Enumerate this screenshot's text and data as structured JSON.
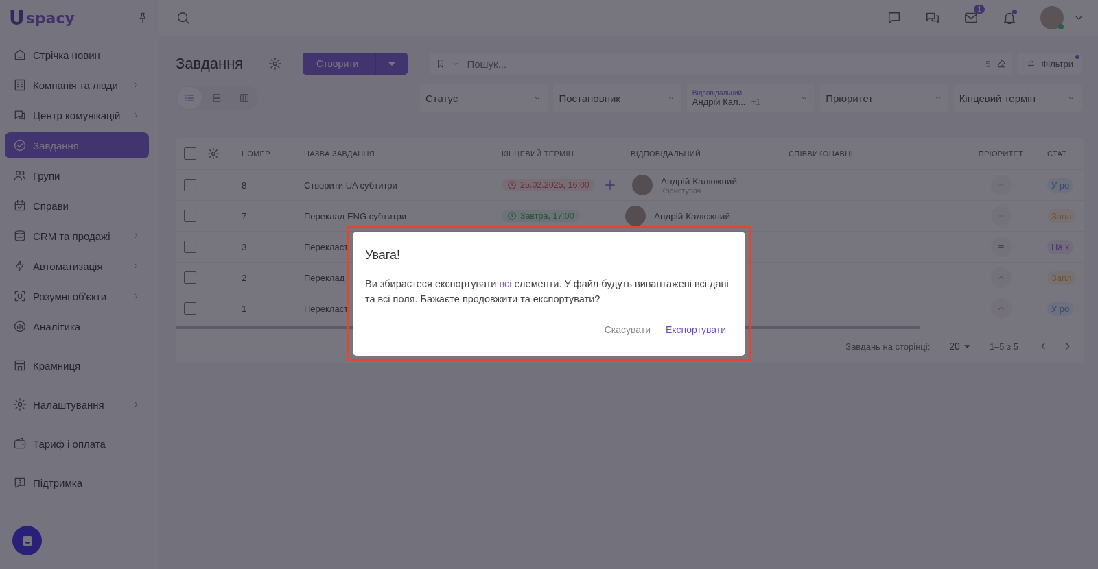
{
  "sidebar": {
    "logo": {
      "letter": "U",
      "text": "spacy"
    },
    "sections": [
      {
        "items": [
          {
            "label": "Стрічка новин",
            "kind": "home",
            "submenu": false,
            "selected": false
          },
          {
            "label": "Компанія та люди",
            "kind": "building",
            "submenu": true,
            "selected": false
          },
          {
            "label": "Центр комунікацій",
            "kind": "chat",
            "submenu": true,
            "selected": false
          },
          {
            "label": "Завдання",
            "kind": "check",
            "submenu": false,
            "selected": true
          },
          {
            "label": "Групи",
            "kind": "people",
            "submenu": false,
            "selected": false
          },
          {
            "label": "Справи",
            "kind": "calendar",
            "submenu": false,
            "selected": false
          },
          {
            "label": "CRM та продажі",
            "kind": "stack",
            "submenu": true,
            "selected": false
          },
          {
            "label": "Автоматизація",
            "kind": "bolt",
            "submenu": true,
            "selected": false
          },
          {
            "label": "Розумні об'єкти",
            "kind": "scan",
            "submenu": true,
            "selected": false
          },
          {
            "label": "Аналітика",
            "kind": "chart",
            "submenu": false,
            "selected": false
          }
        ]
      },
      {
        "items": [
          {
            "label": "Крамниця",
            "kind": "shop",
            "submenu": false,
            "selected": false
          }
        ]
      },
      {
        "items": [
          {
            "label": "Налаштування",
            "kind": "gear",
            "submenu": true,
            "selected": false
          }
        ]
      },
      {
        "items": [
          {
            "label": "Тариф і оплата",
            "kind": "wallet",
            "submenu": false,
            "selected": false
          }
        ]
      },
      {
        "items": [
          {
            "label": "Підтримка",
            "kind": "help",
            "submenu": false,
            "selected": false
          }
        ]
      }
    ]
  },
  "topbar": {
    "mail_badge": "1",
    "notification_dot": true
  },
  "page": {
    "title": "Завдання",
    "create_button": "Створити",
    "search": {
      "placeholder": "Пошук...",
      "count": "5"
    },
    "filters_button": "Фільтри",
    "filters_active": true,
    "views": [
      {
        "kind": "list",
        "selected": true
      },
      {
        "kind": "rows",
        "selected": false
      },
      {
        "kind": "columns",
        "selected": false
      }
    ],
    "filters": [
      {
        "label": "Статус"
      },
      {
        "label": "Постановник"
      },
      {
        "caption": "Відповідальний",
        "value": "Андрій Кал...",
        "extra": "+1"
      },
      {
        "label": "Пріоритет"
      },
      {
        "label": "Кінцевий термін"
      }
    ]
  },
  "table": {
    "columns": [
      "НОМЕР",
      "НАЗВА ЗАВДАННЯ",
      "КІНЦЕВИЙ ТЕРМІН",
      "ВІДПОВІДАЛЬНИЙ",
      "СПІВВИКОНАВЦІ",
      "ПРІОРИТЕТ",
      "СТАТ"
    ],
    "all_checked": false,
    "rows": [
      {
        "checked": false,
        "number": "8",
        "name": "Створити UA субтитри",
        "deadline": {
          "text": "25.02.2025, 16:00",
          "kind": "overdue"
        },
        "add_shown": true,
        "assignee": {
          "name": "Андрій Калюжний",
          "role": "Користувач"
        },
        "priority": {
          "kind": "medium"
        },
        "status": {
          "text": "У ро",
          "kind": "in_progress"
        }
      },
      {
        "checked": false,
        "number": "7",
        "name": "Переклад ENG субтитри",
        "deadline": {
          "text": "Завтра, 17:00",
          "kind": "soon"
        },
        "add_shown": false,
        "assignee": {
          "name": "Андрій Калюжний"
        },
        "priority": {
          "kind": "medium"
        },
        "status": {
          "text": "Запл",
          "kind": "planned"
        }
      },
      {
        "checked": false,
        "number": "3",
        "name": "Перекласт",
        "priority": {
          "kind": "medium"
        },
        "status": {
          "text": "На к",
          "kind": "review"
        }
      },
      {
        "checked": false,
        "number": "2",
        "name": "Переклад",
        "priority": {
          "kind": "high"
        },
        "status": {
          "text": "Запл",
          "kind": "planned"
        }
      },
      {
        "checked": false,
        "number": "1",
        "name": "Перекласт",
        "priority": {
          "kind": "high"
        },
        "status": {
          "text": "У ро",
          "kind": "in_progress"
        }
      }
    ],
    "footer": {
      "per_page_label": "Завдань на сторінці:",
      "per_page": "20",
      "range": "1–5 з 5"
    }
  },
  "dialog": {
    "title": "Увага!",
    "message": [
      {
        "text": "Ви збираєтеся експортувати ",
        "highlight": false
      },
      {
        "text": "всі",
        "highlight": true
      },
      {
        "text": " елементи. У файл будуть вивантажені всі дані та всі поля. Бажаєте продовжити та експортувати?",
        "highlight": false
      }
    ],
    "buttons": [
      {
        "label": "Скасувати",
        "primary": false
      },
      {
        "label": "Експортувати",
        "primary": true
      }
    ]
  }
}
